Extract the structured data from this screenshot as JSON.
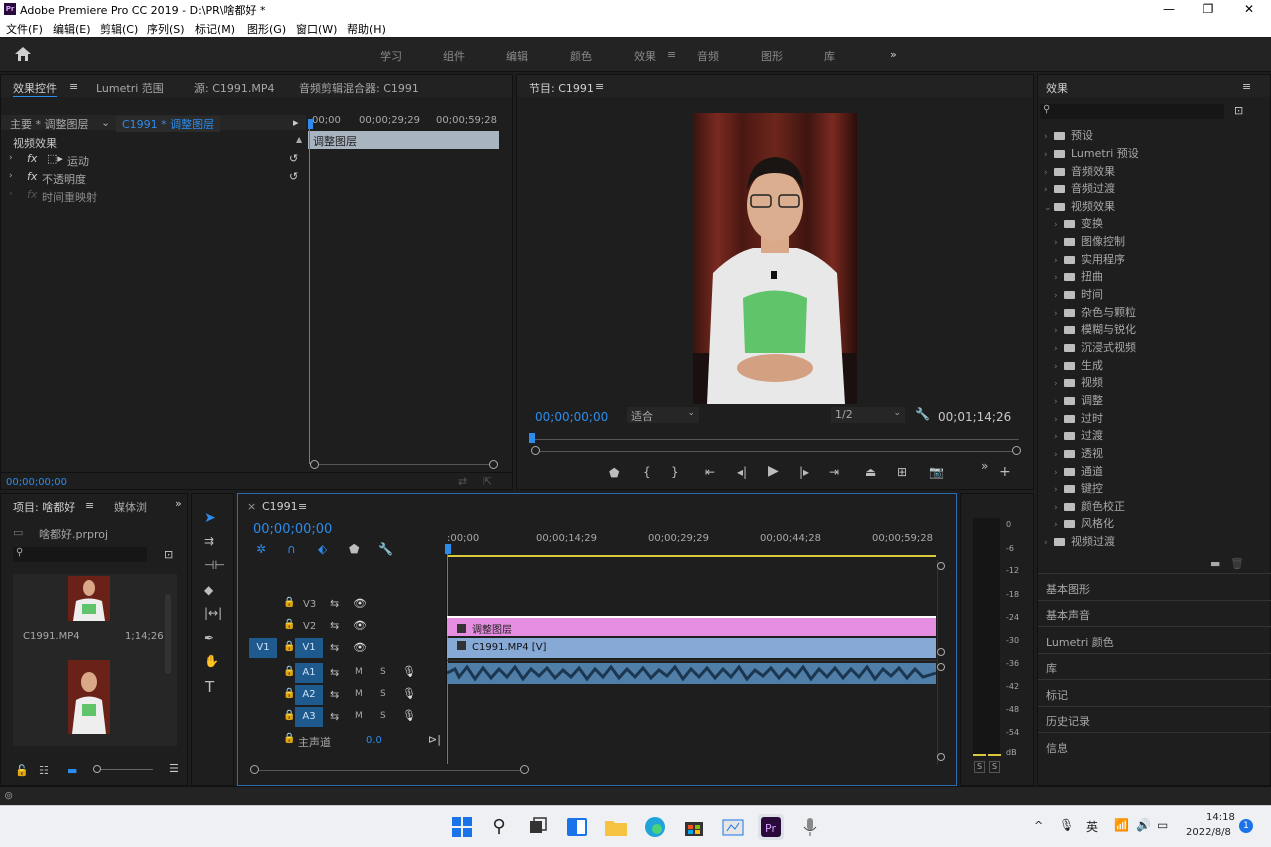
{
  "window": {
    "title": "Adobe Premiere Pro CC 2019 - D:\\PR\\啥都好 *",
    "logo": "Pr"
  },
  "menu": [
    "文件(F)",
    "编辑(E)",
    "剪辑(C)",
    "序列(S)",
    "标记(M)",
    "图形(G)",
    "窗口(W)",
    "帮助(H)"
  ],
  "workspaces": [
    "学习",
    "组件",
    "编辑",
    "颜色",
    "效果",
    "音频",
    "图形",
    "库"
  ],
  "active_workspace": "效果",
  "effect_controls": {
    "tabs": [
      "效果控件",
      "Lumetri 范围",
      "源: C1991.MP4",
      "音频剪辑混合器: C1991"
    ],
    "source_label": "主要 * 调整图层",
    "seq_label": "C1991 * 调整图层",
    "section": "视频效果",
    "effects": [
      "运动",
      "不透明度",
      "时间重映射"
    ],
    "ruler": [
      "00;00",
      "00;00;29;29",
      "00;00;59;28"
    ],
    "clip_label": "调整图层",
    "timecode": "00;00;00;00"
  },
  "program": {
    "title": "节目: C1991",
    "timecode": "00;00;00;00",
    "fit": "适合",
    "res": "1/2",
    "duration": "00;01;14;26"
  },
  "effects_panel": {
    "title": "效果",
    "items": [
      {
        "label": "预设",
        "level": 0,
        "open": false
      },
      {
        "label": "Lumetri 预设",
        "level": 0,
        "open": false
      },
      {
        "label": "音频效果",
        "level": 0,
        "open": false
      },
      {
        "label": "音频过渡",
        "level": 0,
        "open": false
      },
      {
        "label": "视频效果",
        "level": 0,
        "open": true
      },
      {
        "label": "变换",
        "level": 1
      },
      {
        "label": "图像控制",
        "level": 1
      },
      {
        "label": "实用程序",
        "level": 1
      },
      {
        "label": "扭曲",
        "level": 1
      },
      {
        "label": "时间",
        "level": 1
      },
      {
        "label": "杂色与颗粒",
        "level": 1
      },
      {
        "label": "模糊与锐化",
        "level": 1
      },
      {
        "label": "沉浸式视频",
        "level": 1
      },
      {
        "label": "生成",
        "level": 1
      },
      {
        "label": "视频",
        "level": 1
      },
      {
        "label": "调整",
        "level": 1
      },
      {
        "label": "过时",
        "level": 1
      },
      {
        "label": "过渡",
        "level": 1
      },
      {
        "label": "透视",
        "level": 1
      },
      {
        "label": "通道",
        "level": 1
      },
      {
        "label": "键控",
        "level": 1
      },
      {
        "label": "颜色校正",
        "level": 1
      },
      {
        "label": "风格化",
        "level": 1
      },
      {
        "label": "视频过渡",
        "level": 0,
        "open": false
      }
    ],
    "sections": [
      "基本图形",
      "基本声音",
      "Lumetri 颜色",
      "库",
      "标记",
      "历史记录",
      "信息"
    ]
  },
  "project": {
    "title": "项目: 啥都好",
    "tab2": "媒体浏",
    "file": "啥都好.prproj",
    "clip_name": "C1991.MP4",
    "clip_dur": "1;14;26"
  },
  "timeline": {
    "title": "C1991",
    "timecode": "00;00;00;00",
    "ruler": [
      ":00;00",
      "00;00;14;29",
      "00;00;29;29",
      "00;00;44;28",
      "00;00;59;28"
    ],
    "tracks_v": [
      "V3",
      "V2",
      "V1"
    ],
    "tracks_a": [
      "A1",
      "A2",
      "A3"
    ],
    "src_patch": "V1",
    "master": "主声道",
    "master_val": "0.0",
    "clip_adj": "调整图层",
    "clip_v1": "C1991.MP4 [V]",
    "m": "M",
    "s": "S"
  },
  "meter": {
    "scale": [
      "0",
      "-6",
      "-12",
      "-18",
      "-24",
      "-30",
      "-36",
      "-42",
      "-48",
      "-54",
      "dB"
    ],
    "solo": [
      "S",
      "S"
    ]
  },
  "taskbar": {
    "time": "14:18",
    "date": "2022/8/8",
    "lang": "英",
    "notify": "1"
  }
}
